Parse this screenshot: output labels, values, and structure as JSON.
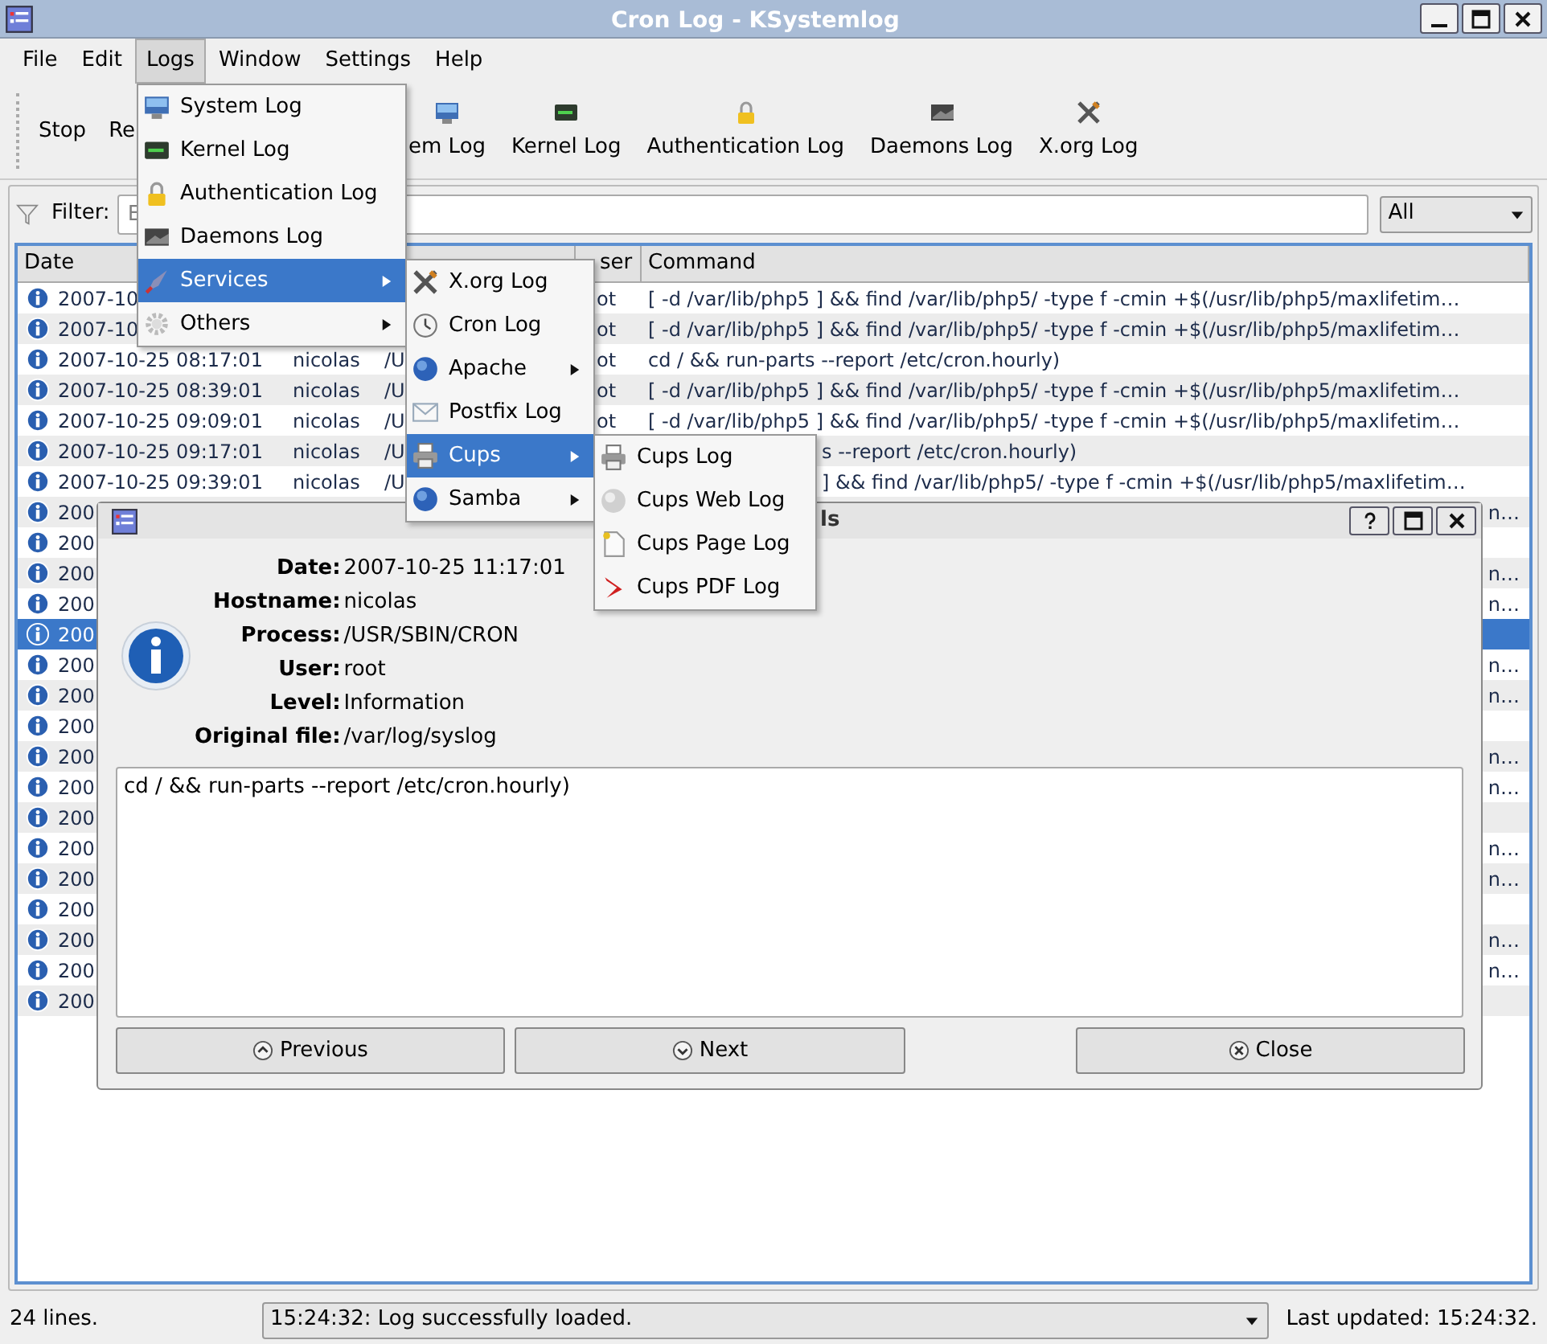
{
  "window": {
    "title": "Cron Log - KSystemlog"
  },
  "menu_bar": [
    {
      "label": "File",
      "selected": false
    },
    {
      "label": "Edit",
      "selected": false
    },
    {
      "label": "Logs",
      "selected": true
    },
    {
      "label": "Window",
      "selected": false
    },
    {
      "label": "Settings",
      "selected": false
    },
    {
      "label": "Help",
      "selected": false
    }
  ],
  "toolbar": [
    {
      "label": "Stop"
    },
    {
      "label": "Re"
    },
    {
      "label": "em Log"
    },
    {
      "label": "Kernel Log"
    },
    {
      "label": "Authentication Log"
    },
    {
      "label": "Daemons Log"
    },
    {
      "label": "X.org Log"
    }
  ],
  "filter": {
    "label": "Filter:",
    "placeholder": "E"
  },
  "level_filter": {
    "value": "All"
  },
  "table": {
    "columns": [
      "Date",
      "ser",
      "Command"
    ],
    "rows": [
      {
        "date": "2007-10",
        "user": "ot",
        "command": "[ -d /var/lib/php5 ] && find /var/lib/php5/ -type f -cmin +$(/usr/lib/php5/maxlifetim…",
        "selected": false
      },
      {
        "date": "2007-10",
        "user": "ot",
        "command": "[ -d /var/lib/php5 ] && find /var/lib/php5/ -type f -cmin +$(/usr/lib/php5/maxlifetim…",
        "selected": false
      },
      {
        "date": "2007-10-25 08:17:01",
        "hostname": "nicolas",
        "process": "/U",
        "user": "ot",
        "command": "cd / && run-parts --report /etc/cron.hourly)",
        "selected": false
      },
      {
        "date": "2007-10-25 08:39:01",
        "hostname": "nicolas",
        "process": "/U",
        "user": "ot",
        "command": "[ -d /var/lib/php5 ] && find /var/lib/php5/ -type f -cmin +$(/usr/lib/php5/maxlifetim…",
        "selected": false
      },
      {
        "date": "2007-10-25 09:09:01",
        "hostname": "nicolas",
        "process": "/U",
        "user": "ot",
        "command": "[ -d /var/lib/php5 ] && find /var/lib/php5/ -type f -cmin +$(/usr/lib/php5/maxlifetim…",
        "selected": false
      },
      {
        "date": "2007-10-25 09:17:01",
        "hostname": "nicolas",
        "process": "/U",
        "command_after_menu": "s --report /etc/cron.hourly)",
        "selected": false
      },
      {
        "date": "2007-10-25 09:39:01",
        "hostname": "nicolas",
        "process": "/U",
        "command_after_menu": "] && find /var/lib/php5/ -type f -cmin +$(/usr/lib/php5/maxlifetim…",
        "selected": false
      },
      {
        "date": "200",
        "command_tail": "n…",
        "selected": false
      },
      {
        "date": "200",
        "selected": false
      },
      {
        "date": "200",
        "command_tail": "n…",
        "selected": false
      },
      {
        "date": "200",
        "command_tail": "n…",
        "selected": false
      },
      {
        "date": "200",
        "selected": true
      },
      {
        "date": "200",
        "command_tail": "n…",
        "selected": false
      },
      {
        "date": "200",
        "command_tail": "n…",
        "selected": false
      },
      {
        "date": "200",
        "selected": false
      },
      {
        "date": "200",
        "command_tail": "n…",
        "selected": false
      },
      {
        "date": "200",
        "command_tail": "n…",
        "selected": false
      },
      {
        "date": "200",
        "selected": false
      },
      {
        "date": "200",
        "command_tail": "n…",
        "selected": false
      },
      {
        "date": "200",
        "command_tail": "n…",
        "selected": false
      },
      {
        "date": "200",
        "selected": false
      },
      {
        "date": "200",
        "command_tail": "n…",
        "selected": false
      },
      {
        "date": "200",
        "command_tail": "n…",
        "selected": false
      },
      {
        "date": "200",
        "selected": false
      }
    ]
  },
  "status_bar": {
    "lines": "24 lines.",
    "message": "15:24:32: Log successfully loaded.",
    "last_updated": "Last updated: 15:24:32."
  },
  "logs_menu": [
    {
      "label": "System Log",
      "submenu": false,
      "selected": false
    },
    {
      "label": "Kernel Log",
      "submenu": false,
      "selected": false
    },
    {
      "label": "Authentication Log",
      "submenu": false,
      "selected": false
    },
    {
      "label": "Daemons Log",
      "submenu": false,
      "selected": false
    },
    {
      "label": "Services",
      "submenu": true,
      "selected": true
    },
    {
      "label": "Others",
      "submenu": true,
      "selected": false
    }
  ],
  "services_menu": [
    {
      "label": "X.org Log",
      "submenu": false,
      "selected": false
    },
    {
      "label": "Cron Log",
      "submenu": false,
      "selected": false
    },
    {
      "label": "Apache",
      "submenu": true,
      "selected": false
    },
    {
      "label": "Postfix Log",
      "submenu": false,
      "selected": false
    },
    {
      "label": "Cups",
      "submenu": true,
      "selected": true
    },
    {
      "label": "Samba",
      "submenu": true,
      "selected": false
    }
  ],
  "cups_menu": [
    {
      "label": "Cups Log",
      "submenu": false,
      "selected": false
    },
    {
      "label": "Cups Web Log",
      "submenu": false,
      "selected": false
    },
    {
      "label": "Cups Page Log",
      "submenu": false,
      "selected": false
    },
    {
      "label": "Cups PDF Log",
      "submenu": false,
      "selected": false
    }
  ],
  "dialog": {
    "title": "ls",
    "fields": [
      {
        "label": "Date:",
        "value": "2007-10-25 11:17:01"
      },
      {
        "label": "Hostname:",
        "value": "nicolas"
      },
      {
        "label": "Process:",
        "value": "/USR/SBIN/CRON"
      },
      {
        "label": "User:",
        "value": "root"
      },
      {
        "label": "Level:",
        "value": "Information"
      },
      {
        "label": "Original file:",
        "value": "/var/log/syslog"
      }
    ],
    "message": "cd / && run-parts --report /etc/cron.hourly)",
    "buttons": [
      "Previous",
      "Next",
      "Close"
    ]
  }
}
